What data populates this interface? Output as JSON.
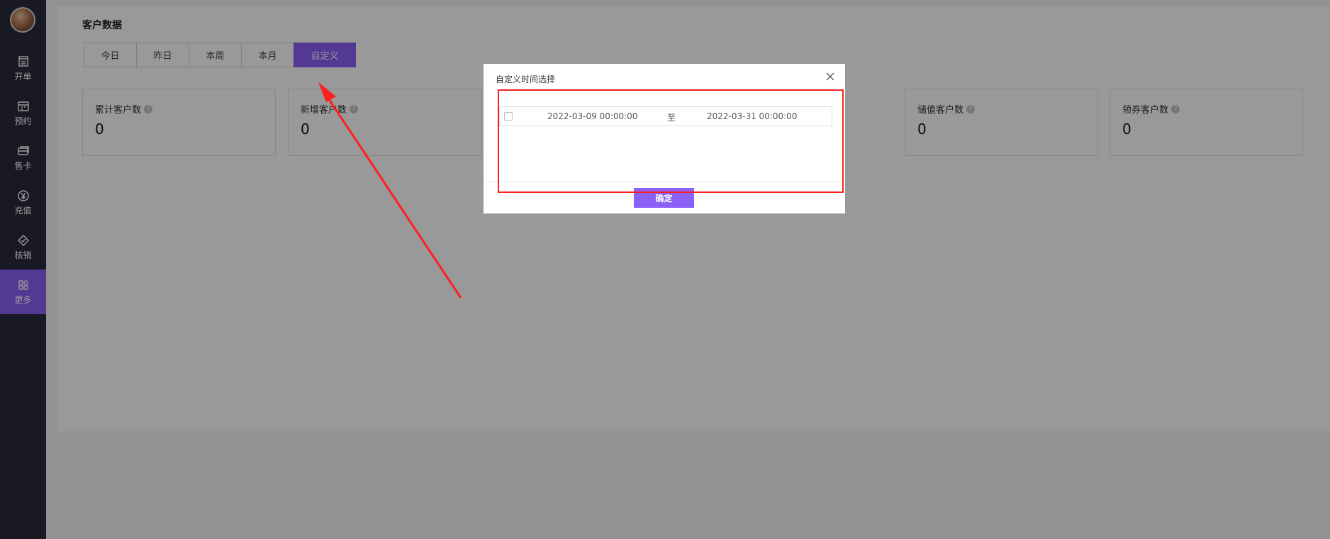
{
  "sidebar": {
    "items": [
      {
        "label": "开单",
        "icon": "store-icon"
      },
      {
        "label": "预约",
        "icon": "calendar-book-icon"
      },
      {
        "label": "售卡",
        "icon": "card-icon"
      },
      {
        "label": "充值",
        "icon": "yen-coin-icon"
      },
      {
        "label": "核销",
        "icon": "ticket-check-icon"
      },
      {
        "label": "更多",
        "icon": "grid-icon",
        "active": true
      }
    ]
  },
  "main": {
    "title": "客户数据",
    "tabs": [
      "今日",
      "昨日",
      "本周",
      "本月",
      "自定义"
    ],
    "active_tab": "自定义",
    "cards": [
      {
        "label": "累计客户数",
        "value": "0"
      },
      {
        "label": "新增客户数",
        "value": "0"
      },
      {
        "label": "储值客户数",
        "value": "0"
      },
      {
        "label": "领券客户数",
        "value": "0"
      }
    ]
  },
  "modal": {
    "title": "自定义时间选择",
    "start": "2022-03-09 00:00:00",
    "separator": "至",
    "end": "2022-03-31 00:00:00",
    "confirm_label": "确定"
  },
  "colors": {
    "accent": "#8a60f5",
    "sidebar_bg": "#2a2a3c",
    "annotation": "#ff1f1f"
  }
}
